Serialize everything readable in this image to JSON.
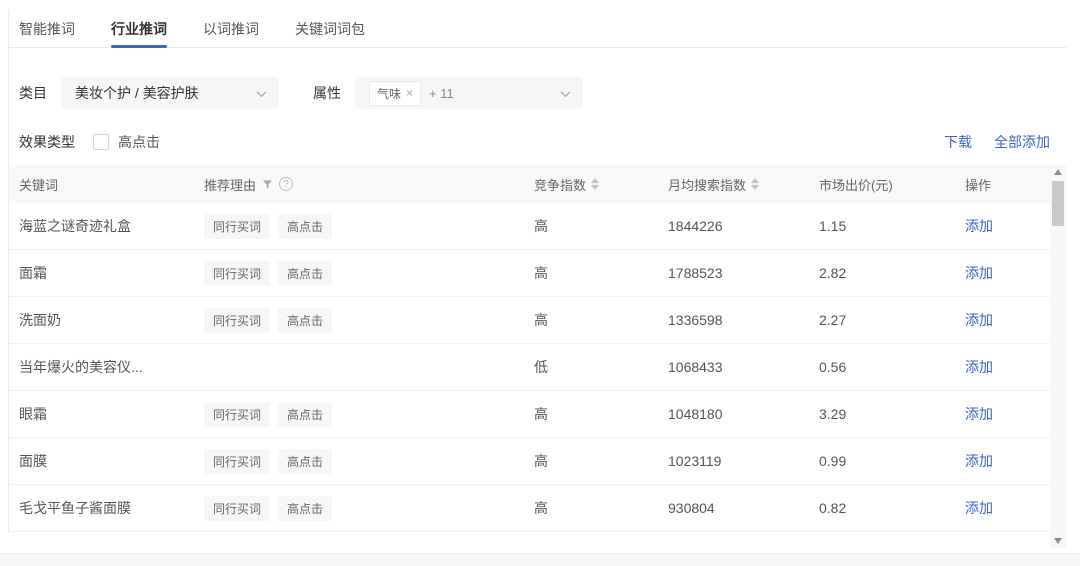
{
  "tabs": {
    "items": [
      {
        "label": "智能推词"
      },
      {
        "label": "行业推词"
      },
      {
        "label": "以词推词"
      },
      {
        "label": "关键词词包"
      }
    ],
    "active_index": 1
  },
  "filters": {
    "category": {
      "label": "类目",
      "value": "美妆个护 / 美容护肤"
    },
    "attribute": {
      "label": "属性",
      "tag": "气味",
      "tag_close": "×",
      "more": "+ 11"
    },
    "effect": {
      "label": "效果类型",
      "option": "高点击",
      "checked": false
    }
  },
  "toolbar": {
    "download": "下载",
    "add_all": "全部添加"
  },
  "table": {
    "columns": [
      "关键词",
      "推荐理由",
      "竞争指数",
      "月均搜索指数",
      "市场出价(元)",
      "操作"
    ],
    "rows": [
      {
        "keyword": "海蓝之谜奇迹礼盒",
        "tags": [
          "同行买词",
          "高点击"
        ],
        "competition": "高",
        "search_index": "1844226",
        "price": "1.15",
        "action": "添加"
      },
      {
        "keyword": "面霜",
        "tags": [
          "同行买词",
          "高点击"
        ],
        "competition": "高",
        "search_index": "1788523",
        "price": "2.82",
        "action": "添加"
      },
      {
        "keyword": "洗面奶",
        "tags": [
          "同行买词",
          "高点击"
        ],
        "competition": "高",
        "search_index": "1336598",
        "price": "2.27",
        "action": "添加"
      },
      {
        "keyword": "当年爆火的美容仪...",
        "tags": [],
        "competition": "低",
        "search_index": "1068433",
        "price": "0.56",
        "action": "添加"
      },
      {
        "keyword": "眼霜",
        "tags": [
          "同行买词",
          "高点击"
        ],
        "competition": "高",
        "search_index": "1048180",
        "price": "3.29",
        "action": "添加"
      },
      {
        "keyword": "面膜",
        "tags": [
          "同行买词",
          "高点击"
        ],
        "competition": "高",
        "search_index": "1023119",
        "price": "0.99",
        "action": "添加"
      },
      {
        "keyword": "毛戈平鱼子酱面膜",
        "tags": [
          "同行买词",
          "高点击"
        ],
        "competition": "高",
        "search_index": "930804",
        "price": "0.82",
        "action": "添加"
      }
    ]
  },
  "colors": {
    "accent": "#3d62c9",
    "header_bg": "#f7f8fa"
  }
}
